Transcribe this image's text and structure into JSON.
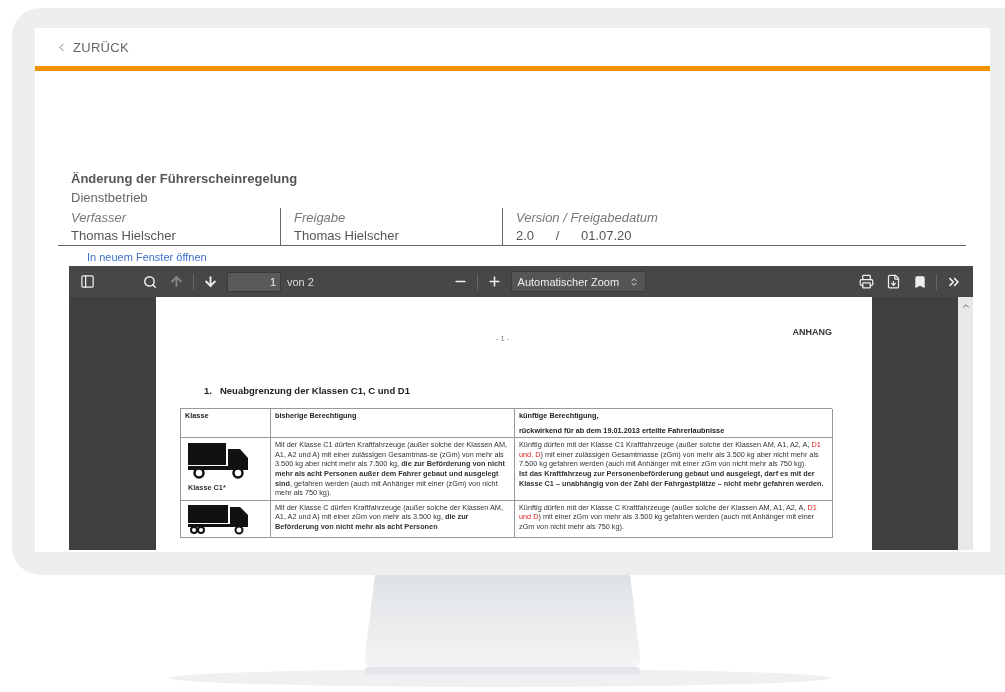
{
  "back_link": {
    "label": "ZURÜCK"
  },
  "document": {
    "title": "Änderung der Führerscheinregelung",
    "department": "Dienstbetrieb",
    "meta": [
      {
        "label": "Verfasser",
        "value": "Thomas Hielscher"
      },
      {
        "label": "Freigabe",
        "value": "Thomas Hielscher"
      },
      {
        "label": "Version / Freigabedatum",
        "value": "2.0 / 01.07.20"
      }
    ]
  },
  "open_link": "In neuem Fenster öffnen",
  "viewer": {
    "toolbar": {
      "page": "1",
      "page_count": "von 2",
      "zoom": "Automatischer Zoom",
      "prev_disabled": true
    },
    "page": {
      "page_number": "- 1 -",
      "header": "ANHANG",
      "heading_number": "1.",
      "heading": "Neuabgrenzung der Klassen C1, C und D1",
      "table": {
        "columns": [
          {
            "label": "Klasse"
          },
          {
            "label": "bisherige Berechtigung"
          },
          {
            "label": "künftige Berechtigung,",
            "note": "rückwirkend für ab dem 19.01.2013 erteilte Fahrerlaubnisse"
          }
        ],
        "rows": [
          {
            "kind": "light_truck",
            "class_label": "Klasse C1*",
            "previous": [
              {
                "kind": "plain",
                "text": "Mit der Klasse C1 dürfen Kraftfahrzeuge (außer solche der Klassen AM, A1, A2 und A) mit einer zulässigen Gesamtmas-se (zGm) von mehr als 3.500 kg aber nicht mehr als 7.500 kg, "
              },
              {
                "kind": "bold",
                "text": "die zur Beförderung von nicht mehr als acht Personen außer dem Fahrer gebaut und ausgelegt sind"
              },
              {
                "kind": "plain",
                "text": ", gefahren werden (auch mit Anhänger mit einer (zGm) von nicht mehr als 750 kg)."
              }
            ],
            "future": [
              [
                {
                  "kind": "plain",
                  "text": "Künftig dürfen mit der Klasse C1 Kraftfahrzeuge (außer solche der Klassen AM, A1, A2, A, "
                },
                {
                  "kind": "red",
                  "text": "D1 und. D"
                },
                {
                  "kind": "plain",
                  "text": ") mit einer zulässigen Gesamtmasse (zGm) von mehr als 3.500 kg aber nicht mehr als 7.500 kg gefahren werden (auch mit Anhänger mit einer zGm von nicht mehr als 750 kg)."
                }
              ],
              [
                {
                  "kind": "bold",
                  "text": "Ist das Kraftfahrzeug zur Personenbeförderung gebaut und ausgelegt, darf es mit der Klasse C1 – unabhängig von der Zahl der Fahrgastplätze – nicht mehr gefahren werden."
                }
              ]
            ]
          },
          {
            "kind": "heavy_truck",
            "previous": [
              {
                "kind": "plain",
                "text": "Mit der Klasse C dürfen Kraftfahrzeuge (außer solche der Klassen AM, A1, A2 und A) mit einer zGm von mehr als 3.500 kg, "
              },
              {
                "kind": "bold",
                "text": "die zur Beförderung von nicht mehr als acht Personen"
              }
            ],
            "future": [
              [
                {
                  "kind": "plain",
                  "text": "Künftig dürfen mit der Klasse C Kraftfahrzeuge (außer solche der Klassen AM, A1, A2, A, "
                },
                {
                  "kind": "red",
                  "text": "D1 und D"
                },
                {
                  "kind": "plain",
                  "text": ") mit einer zGm von mehr als 3.500 kg gefahren werden (auch mit Anhänger mit einer zGm von nicht mehr als 750 kg)."
                }
              ]
            ]
          }
        ]
      }
    }
  }
}
